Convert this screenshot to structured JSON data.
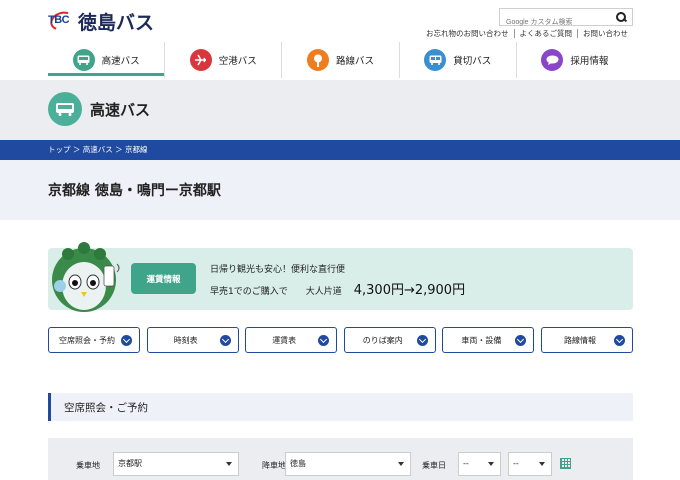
{
  "header": {
    "logo_mark": "TBC",
    "logo_text": "徳島バス",
    "search_placeholder": "Google カスタム検索",
    "utils": [
      "お忘れ物のお問い合わせ",
      "よくあるご質問",
      "お問い合わせ"
    ]
  },
  "nav": [
    {
      "label": "高速バス",
      "icon": "bus-icon",
      "color": "#3fa48a",
      "active": true
    },
    {
      "label": "空港バス",
      "icon": "airplane-icon",
      "color": "#d9363e",
      "active": false
    },
    {
      "label": "路線バス",
      "icon": "bus-stop-icon",
      "color": "#ef7c1f",
      "active": false
    },
    {
      "label": "貸切バス",
      "icon": "charter-bus-icon",
      "color": "#3a8fd0",
      "active": false
    },
    {
      "label": "採用情報",
      "icon": "speech-bubble-icon",
      "color": "#8b45c8",
      "active": false
    }
  ],
  "page": {
    "title": "高速バス",
    "breadcrumb": "トップ ＞ 高速バス ＞ 京都線",
    "route_title": "京都線 徳島・鳴門ー京都駅"
  },
  "promo": {
    "button": "運賃情報",
    "line1": "日帰り観光も安心！便利な直行便",
    "presale": "早売1でのご購入で",
    "oneway": "大人片道",
    "price": "4,300円→2,900円"
  },
  "tabs": [
    "空席照会・予約",
    "時刻表",
    "運賃表",
    "のりば案内",
    "車両・設備",
    "路線情報"
  ],
  "section": {
    "heading": "空席照会・ご予約"
  },
  "form": {
    "board_label": "乗車地",
    "board_value": "京都駅",
    "alight_label": "降車地",
    "alight_value": "徳島",
    "date_label": "乗車日",
    "month_value": "--",
    "day_value": "--"
  },
  "colors": {
    "accent_green": "#3fa48a",
    "brand_blue": "#1f4aa0",
    "band_gray": "#ebedf1"
  }
}
